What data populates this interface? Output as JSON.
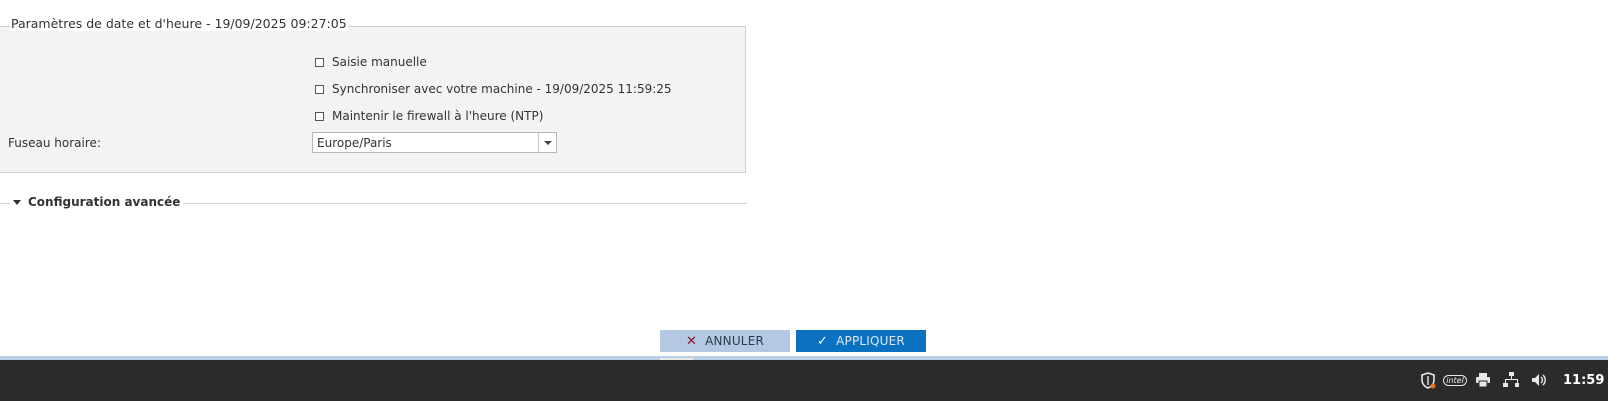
{
  "datetime_panel": {
    "title": "Paramètres de date et d'heure - 19/09/2025 09:27:05",
    "options": [
      {
        "label": "Saisie manuelle",
        "checked": false
      },
      {
        "label": "Synchroniser avec votre machine - 19/09/2025 11:59:25",
        "checked": false
      },
      {
        "label": "Maintenir le firewall à l'heure (NTP)",
        "checked": false
      }
    ],
    "timezone_label": "Fuseau horaire:",
    "timezone_value": "Europe/Paris"
  },
  "advanced": {
    "label": "Configuration avancée",
    "expanded": true
  },
  "buttons": {
    "cancel_label": "ANNULER",
    "apply_label": "APPLIQUER"
  },
  "taskbar": {
    "tray_icons": [
      "security-shield-icon",
      "intel-graphics-icon",
      "printer-icon",
      "network-icon",
      "volume-icon"
    ],
    "intel_text": "intel",
    "clock": "11:59"
  },
  "colors": {
    "cancel_bg": "#b3c9e3",
    "apply_bg": "#0a72c0",
    "cancel_icon": "#8a1535",
    "taskbar_bg": "#2b2b2b",
    "panel_bg": "#f3f3f3"
  }
}
